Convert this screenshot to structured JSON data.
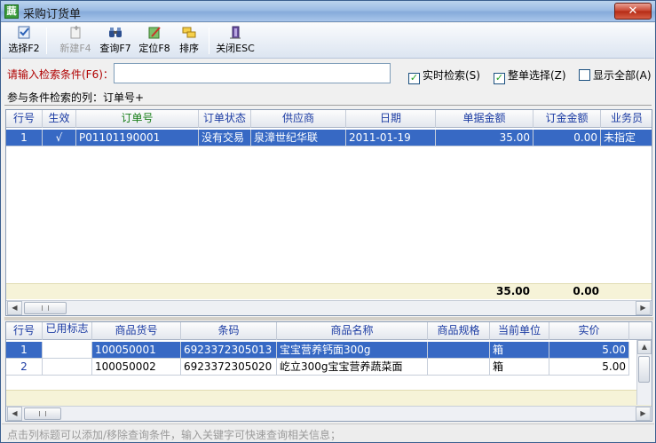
{
  "window": {
    "title": "采购订货单",
    "app_icon": "蔬",
    "close_label": "✕"
  },
  "toolbar": {
    "select": "选择F2",
    "new": "新建F4",
    "query": "查询F7",
    "locate": "定位F8",
    "sort": "排序",
    "close": "关闭ESC"
  },
  "search": {
    "label": "请输入检索条件(F6)：",
    "value": "",
    "realtime": {
      "label": "实时检索(S)",
      "checked": true
    },
    "whole": {
      "label": "整单选择(Z)",
      "checked": true
    },
    "showall": {
      "label": "显示全部(A)",
      "checked": false
    }
  },
  "condition": "参与条件检索的列：订单号+",
  "orders": {
    "headers": [
      "行号",
      "生效",
      "订单号",
      "订单状态",
      "供应商",
      "日期",
      "单据金额",
      "订金金额",
      "业务员"
    ],
    "rows": [
      {
        "rn": "1",
        "eff": "√",
        "no": "P01101190001",
        "status": "没有交易",
        "supplier": "泉漳世纪华联",
        "date": "2011-01-19",
        "amount": "35.00",
        "deposit": "0.00",
        "staff": "未指定"
      }
    ],
    "totals": {
      "amount": "35.00",
      "deposit": "0.00"
    }
  },
  "items": {
    "headers": [
      "行号",
      "已用标志",
      "商品货号",
      "条码",
      "商品名称",
      "商品规格",
      "当前单位",
      "实价"
    ],
    "rows": [
      {
        "rn": "1",
        "flag": "",
        "code": "100050001",
        "barcode": "6923372305013",
        "name": "宝宝营养钙面300g",
        "spec": "",
        "unit": "箱",
        "price": "5.00"
      },
      {
        "rn": "2",
        "flag": "",
        "code": "100050002",
        "barcode": "6923372305020",
        "name": "屹立300g宝宝营养蔬菜面",
        "spec": "",
        "unit": "箱",
        "price": "5.00"
      }
    ]
  },
  "status": "点击列标题可以添加/移除查询条件，输入关键字可快速查询相关信息；",
  "colors": {
    "selection": "#3769C4",
    "label_red": "#B00000",
    "header_blue": "#1B3BA3"
  }
}
